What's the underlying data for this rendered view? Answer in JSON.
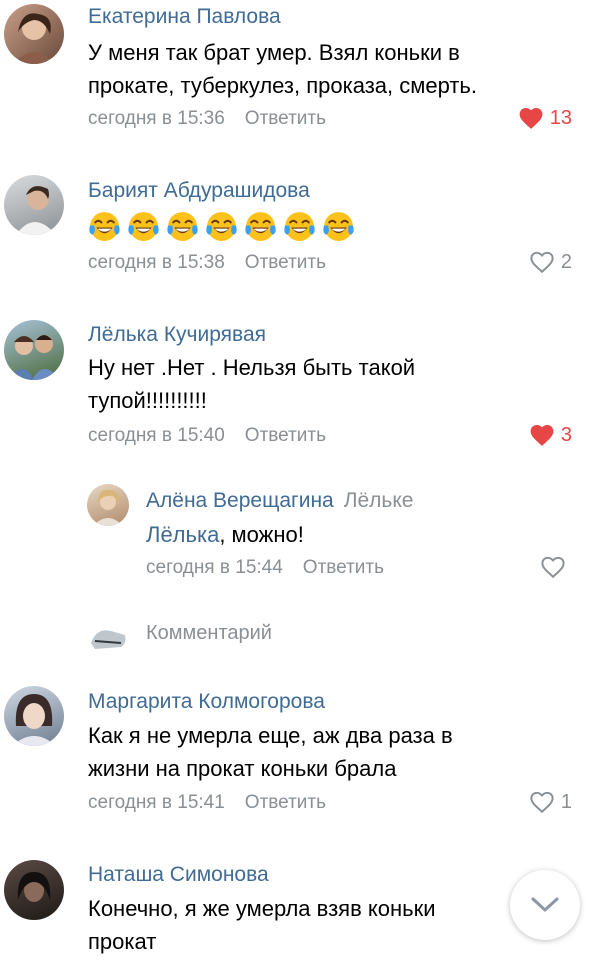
{
  "comments": [
    {
      "author": "Екатерина Павлова",
      "text_lines": [
        "У меня так брат умер. Взял коньки в",
        "прокате, туберкулез, проказа, смерть."
      ],
      "time": "сегодня в 15:36",
      "reply_label": "Ответить",
      "likes": "13",
      "liked": true
    },
    {
      "author": "Барият Абдурашидова",
      "emoji_count": 7,
      "emoji_name": "face-with-tears-of-joy",
      "time": "сегодня в 15:38",
      "reply_label": "Ответить",
      "likes": "2",
      "liked": false
    },
    {
      "author": "Лёлька Кучирявая",
      "text_lines": [
        "Ну нет .Нет . Нельзя быть такой",
        "тупой!!!!!!!!!!"
      ],
      "time": "сегодня в 15:40",
      "reply_label": "Ответить",
      "likes": "3",
      "liked": true
    },
    {
      "author": "Алёна Верещагина",
      "reply_to": "Лёльке",
      "mention": "Лёлька",
      "text_rest": ", можно!",
      "time": "сегодня в 15:44",
      "reply_label": "Ответить",
      "likes": "",
      "liked": false
    },
    {
      "author": "Маргарита Колмогорова",
      "text_lines": [
        "Как я не умерла еще, аж два раза в",
        "жизни на прокат коньки брала"
      ],
      "time": "сегодня в 15:41",
      "reply_label": "Ответить",
      "likes": "1",
      "liked": false
    },
    {
      "author": "Наташа Симонова",
      "text_lines": [
        "Конечно, я же умерла взяв коньки",
        "прокат"
      ]
    }
  ],
  "composer": {
    "placeholder": "Комментарий"
  },
  "colors": {
    "name": "#3f6b95",
    "meta": "#8a8f94",
    "like_active": "#e64646"
  },
  "icons": {
    "like": "heart-icon",
    "scroll": "chevron-down-icon"
  }
}
